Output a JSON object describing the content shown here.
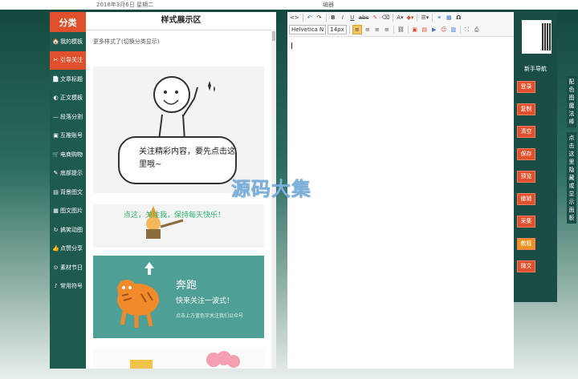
{
  "topbar": {
    "date": "2018年3月6日 星期二",
    "editor_title": "编器"
  },
  "sidebar": {
    "header": "分类",
    "items": [
      {
        "icon": "🏠",
        "label": "我的模板",
        "active": false
      },
      {
        "icon": "✂",
        "label": "引导关注",
        "active": true
      },
      {
        "icon": "📄",
        "label": "文章标题",
        "active": false
      },
      {
        "icon": "◐",
        "label": "正文模板",
        "active": false
      },
      {
        "icon": "—",
        "label": "段落分割",
        "active": false
      },
      {
        "icon": "▣",
        "label": "互推账号",
        "active": false
      },
      {
        "icon": "🛒",
        "label": "电商购物",
        "active": false
      },
      {
        "icon": "✎",
        "label": "底部提示",
        "active": false
      },
      {
        "icon": "▤",
        "label": "背景图文",
        "active": false
      },
      {
        "icon": "▦",
        "label": "图文图片",
        "active": false
      },
      {
        "icon": "↻",
        "label": "搞笑动图",
        "active": false
      },
      {
        "icon": "👍",
        "label": "点赞分享",
        "active": false
      },
      {
        "icon": "⊙",
        "label": "素材节日",
        "active": false
      },
      {
        "icon": "♪",
        "label": "常用符号",
        "active": false
      }
    ]
  },
  "showcase": {
    "title": "样式展示区",
    "hint": "更多样式了(切换分类显示)",
    "tpl1_text": "关注精彩内容，要先点击这里哦~",
    "tpl2_text": "点这，关注我，保持每天快乐！",
    "tpl3_heading": "奔跑",
    "tpl3_sub": "快来关注一波式！",
    "tpl3_small": "点击上方蓝色字关注我们公众号"
  },
  "editor": {
    "font_family": "Helvetica N",
    "font_size": "14px"
  },
  "watermark": "源码大集",
  "actions": {
    "guide": "新手导航",
    "buttons": [
      "登录",
      "复制",
      "清空",
      "保存",
      "预览",
      "撤销",
      "采集",
      "教程",
      "微文"
    ]
  },
  "vertical_tabs": {
    "tab1": "配色图魔法棒",
    "tab2": "点击这里隐藏或显示面板"
  },
  "colors": {
    "accent": "#e0502c",
    "sidebar": "#1f5a4f",
    "panel": "#1a4d45"
  }
}
